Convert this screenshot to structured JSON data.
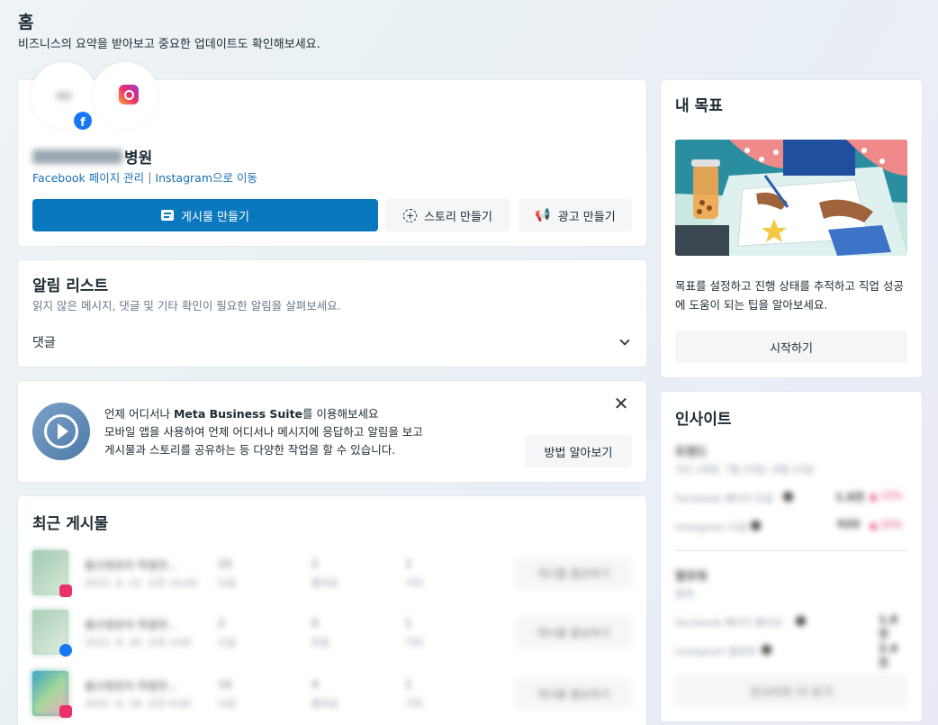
{
  "header": {
    "title": "홈",
    "subtitle": "비즈니스의 요약을 받아보고 중요한 업데이트도 확인해보세요."
  },
  "profile": {
    "facebook_avatar_text": "병원",
    "instagram_avatar_text": "병원",
    "name_suffix": "병원",
    "facebook_link": "Facebook 페이지 관리",
    "link_separator": "|",
    "instagram_link": "Instagram으로 이동",
    "create_post_label": "게시물 만들기",
    "create_story_label": "스토리 만들기",
    "create_ad_label": "광고 만들기"
  },
  "notifications": {
    "title": "알림 리스트",
    "subtitle": "읽지 않은 메시지, 댓글 및 기타 확인이 필요한 알림을 살펴보세요.",
    "item_label": "댓글"
  },
  "promo": {
    "line1_prefix": "언제 어디서나 ",
    "line1_brand": "Meta Business Suite",
    "line1_suffix": "를 이용해보세요",
    "line2": "모바일 앱을 사용하여 언제 어디서나 메시지에 응답하고 알림을 보고",
    "line3": "게시물과 스토리를 공유하는 등 다양한 작업을 할 수 있습니다.",
    "learn_label": "방법 알아보기"
  },
  "recent_posts": {
    "title": "최근 게시물",
    "rows": [
      {
        "title": "출산병원의 특별한...",
        "date": "2022. 8. 22. 오전 10:00",
        "stat1": "10",
        "stat1_label": "도달",
        "stat2": "2",
        "stat2_label": "좋아요",
        "stat3": "1",
        "stat3_label": "기타",
        "action": "게시물 홍보하기"
      },
      {
        "title": "출산병원의 특별한...",
        "date": "2022. 8. 20. 오후 3:00",
        "stat1": "2",
        "stat1_label": "도달",
        "stat2": "0",
        "stat2_label": "반응",
        "stat3": "1",
        "stat3_label": "기타",
        "action": "게시물 홍보하기"
      },
      {
        "title": "출산병원의 특별한...",
        "date": "2022. 8. 18. 오전 9:00",
        "stat1": "14",
        "stat1_label": "도달",
        "stat2": "4",
        "stat2_label": "좋아요",
        "stat3": "1",
        "stat3_label": "기타",
        "action": "게시물 홍보하기"
      }
    ]
  },
  "goals": {
    "title": "내 목표",
    "description": "목표를 설정하고 진행 상태를 추적하고 직업 성공에 도움이 되는 팁을 알아보세요.",
    "start_label": "시작하기"
  },
  "insights": {
    "title": "인사이트",
    "section1_title": "트렌드",
    "section1_sub": "지난 28일: 7월 25일~8월 22일",
    "metric1_label": "Facebook 페이지 도달",
    "metric1_value": "1.6천",
    "metric1_change": "▲ 12%",
    "metric2_label": "Instagram 도달",
    "metric2_value": "920",
    "metric2_change": "▲ 20%",
    "section2_title": "팔로워",
    "section2_sub": "합계",
    "metric3_label": "Facebook 페이지 좋아요",
    "metric3_value": "1.8천",
    "metric4_label": "Instagram 팔로워",
    "metric4_value": "2.4천",
    "more_label": "인사이트 더 보기"
  },
  "colors": {
    "primary": "#0a78be",
    "link": "#1a6fb5",
    "positive": "#e0245e"
  },
  "icons": {
    "post": "post-icon",
    "story": "story-add-icon",
    "ad": "megaphone-icon",
    "chevron": "chevron-down-icon",
    "close": "close-icon",
    "suite": "meta-business-suite-icon"
  }
}
